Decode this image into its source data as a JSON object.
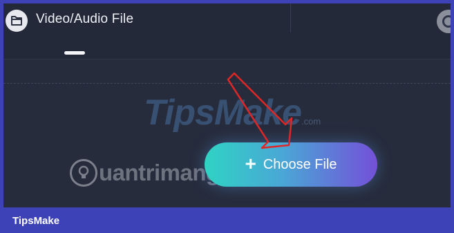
{
  "header": {
    "title": "Video/Audio File",
    "file_icon": "folder-icon",
    "right_icon": "record-icon"
  },
  "upload": {
    "button_label": "Choose File",
    "button_icon": "plus-icon",
    "button_gradient": [
      "#2fd3c3",
      "#4aa7d6",
      "#7450d8"
    ]
  },
  "watermarks": {
    "primary": "TipsMake",
    "primary_suffix": ".com",
    "secondary": "uantrimang"
  },
  "footer": {
    "brand": "TipsMake"
  },
  "colors": {
    "frame_bg": "#262c3c",
    "border": "#3d43b6",
    "annotation_arrow": "#e12626"
  }
}
